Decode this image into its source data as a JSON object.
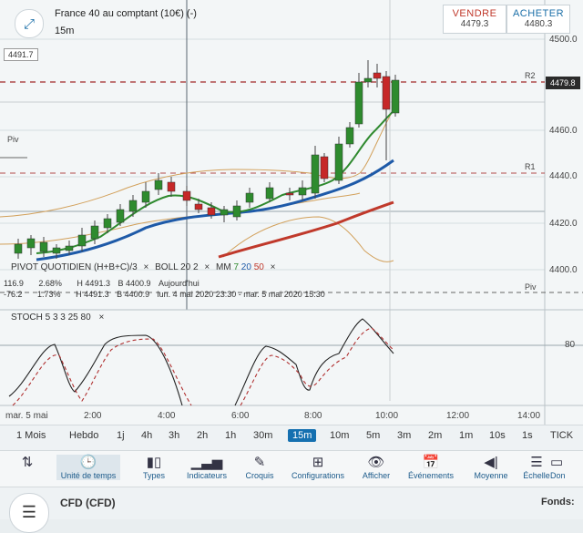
{
  "header": {
    "instrument": "France 40 au comptant (10€) (-)",
    "timeframe": "15m",
    "sell": {
      "label": "VENDRE",
      "price": "4479.3"
    },
    "buy": {
      "label": "ACHETER",
      "price": "4480.3"
    }
  },
  "price_axis": {
    "ticks": [
      "4500.0",
      "4460.0",
      "4440.0",
      "4420.0",
      "4400.0"
    ],
    "current_price": "4479.8",
    "left_flag": "4491.7",
    "r1_flag": "R1"
  },
  "levels": {
    "r2": "R2",
    "r1": "R1",
    "piv_left": "Piv",
    "piv_right": "Piv"
  },
  "indicators": {
    "pivot": "PIVOT QUOTIDIEN (H+B+C)/3",
    "boll": "BOLL 20 2",
    "mm": "MM 7 20 50",
    "mm_values": [
      "7",
      "20",
      "50"
    ],
    "close": "×",
    "row1": [
      "116.9",
      "2.68%",
      "H 4491.3",
      "B 4400.9",
      "Aujourd'hui"
    ],
    "row2": [
      "-76.2",
      "1.73%",
      "H 4491.3",
      "B 4400.9",
      "lun. 4 mai 2020 23:30 - mar. 5 mai 2020 15:30"
    ]
  },
  "stoch": {
    "label": "STOCH 5 3 3 25 80",
    "close": "×",
    "level": "80"
  },
  "time_axis": [
    "mar. 5 mai",
    "2:00",
    "4:00",
    "6:00",
    "8:00",
    "10:00",
    "12:00",
    "14:00"
  ],
  "timeframes": [
    "1 Mois",
    "Hebdo",
    "1j",
    "4h",
    "3h",
    "2h",
    "1h",
    "30m",
    "15m",
    "10m",
    "5m",
    "3m",
    "2m",
    "1m",
    "10s",
    "1s",
    "TICK"
  ],
  "active_timeframe": "15m",
  "tools": [
    {
      "label": "",
      "icon": "sort-icon"
    },
    {
      "label": "Unité de temps",
      "icon": "clock-icon"
    },
    {
      "label": "Types",
      "icon": "candles-icon"
    },
    {
      "label": "Indicateurs",
      "icon": "bar-chart-icon"
    },
    {
      "label": "Croquis",
      "icon": "pencil-icon"
    },
    {
      "label": "Configurations",
      "icon": "layout-icon"
    },
    {
      "label": "Afficher",
      "icon": "eye-icon"
    },
    {
      "label": "Événements",
      "icon": "calendar-icon"
    },
    {
      "label": "Moyenne",
      "icon": "volume-icon"
    },
    {
      "label": "Échelle",
      "icon": "scale-icon"
    },
    {
      "label": "Don",
      "icon": "data-icon"
    }
  ],
  "bottom": {
    "account": "CFD (CFD)",
    "funds": "Fonds:"
  },
  "colors": {
    "up": "#2e8b2e",
    "down": "#c62828",
    "ma7": "#2f8a2f",
    "ma20": "#1e5aa8",
    "ma50": "#c0392b",
    "boll": "#d2a05a",
    "accent": "#1570b0"
  }
}
